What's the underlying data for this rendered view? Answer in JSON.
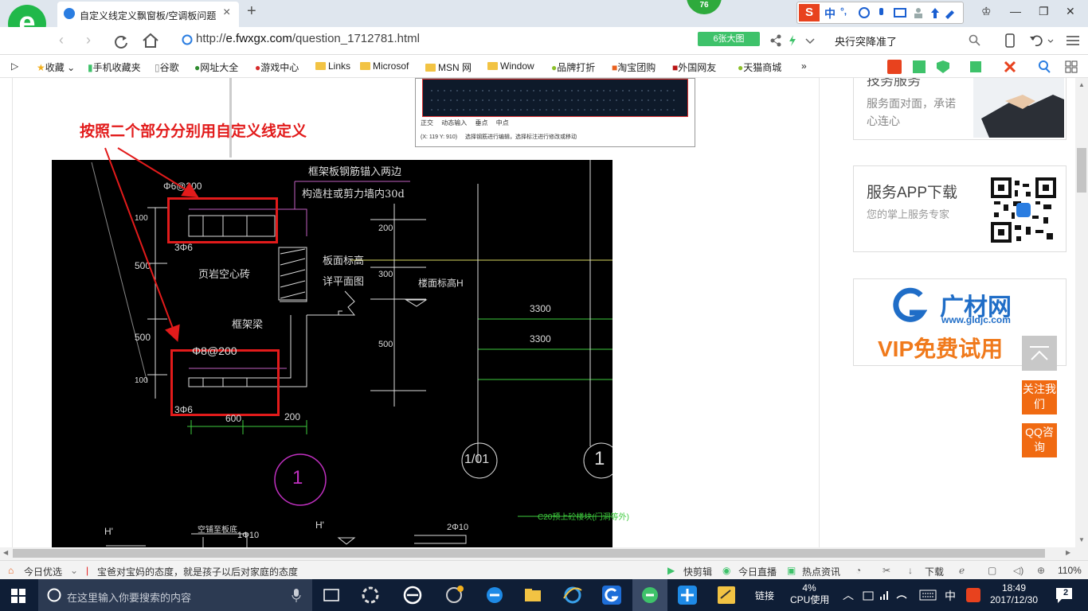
{
  "browser": {
    "tab_title": "自定义线定义飘窗板/空调板问题",
    "tab_close": "×",
    "new_tab": "+",
    "badge_count": "76",
    "ime": {
      "logo": "S",
      "mode": "中",
      "punct": "°,"
    },
    "url_prefix": "http://",
    "url_domain": "e.fwxgx.com",
    "url_path": "/question_1712781.html",
    "big_image_button": "6张大图",
    "search_text": "央行突降准了",
    "bookmarks": [
      "收藏",
      "手机收藏夹",
      "谷歌",
      "网址大全",
      "游戏中心",
      "Links",
      "Microsof",
      "MSN 网",
      "Window",
      "品牌打折",
      "淘宝团购",
      "外国网友",
      "天猫商城"
    ],
    "more_bookmarks": "»"
  },
  "page": {
    "annotation": "按照二个部分分别用自定义线定义",
    "thumbnail": {
      "status_items": [
        "正交",
        "动态输入",
        "垂点",
        "中点"
      ],
      "coords": "(X: 119 Y: 910)",
      "hint": "选择钢筋进行编辑，选择标注进行修改或移动"
    },
    "cad": {
      "top_note_1": "框架板钢筋锚入两边",
      "top_note_2": "构造柱或剪力墙内30d",
      "rebar_top": "Φ6@200",
      "rebar_mid": "Φ8@200",
      "three_phi6_top": "3Φ6",
      "three_phi6_bot": "3Φ6",
      "dim_100_a": "100",
      "dim_500_a": "500",
      "dim_500_b": "500",
      "dim_100_b": "100",
      "brick": "页岩空心砖",
      "beam": "框架梁",
      "slab_elev_1": "板面标高",
      "slab_elev_2": "详平面图",
      "floor_elev": "楼面标高H",
      "dim_200": "200",
      "dim_300": "300",
      "dim_500_c": "500",
      "dim_3300_a": "3300",
      "dim_3300_b": "3300",
      "dim_600": "600",
      "dim_200_b": "200",
      "axis_1": "1",
      "axis_1_01": "1/01",
      "axis_1b": "1",
      "c20": "C20预上砼楼块(门洞等外)",
      "h_prime_a": "H'",
      "h_prime_b": "H'",
      "bottom_note": "空铺至板底",
      "rebar_1phi10": "1Φ10",
      "rebar_2phi10": "2Φ10"
    },
    "sidebar": {
      "card1_title_partial": "技务服务",
      "card1_text": "服务面对面，承诺心连心",
      "card2_title": "服务APP下载",
      "card2_text": "您的掌上服务专家",
      "card3_brand": "广材网",
      "card3_url": "www.gldjc.com",
      "card3_promo": "VIP免费试用"
    },
    "float_buttons": {
      "follow": "关注我们",
      "qq": "QQ咨询"
    }
  },
  "statusbar": {
    "today": "今日优选",
    "news": "宝爸对宝妈的态度，就是孩子以后对家庭的态度",
    "quick_cut": "快剪辑",
    "live": "今日直播",
    "hot": "热点资讯",
    "download": "下载",
    "zoom": "110%"
  },
  "taskbar": {
    "search_placeholder": "在这里输入你要搜索的内容",
    "links": "链接",
    "cpu_percent": "4%",
    "cpu_label": "CPU使用",
    "ime": "中",
    "time": "18:49",
    "date": "2017/12/30",
    "notifications": "2"
  }
}
